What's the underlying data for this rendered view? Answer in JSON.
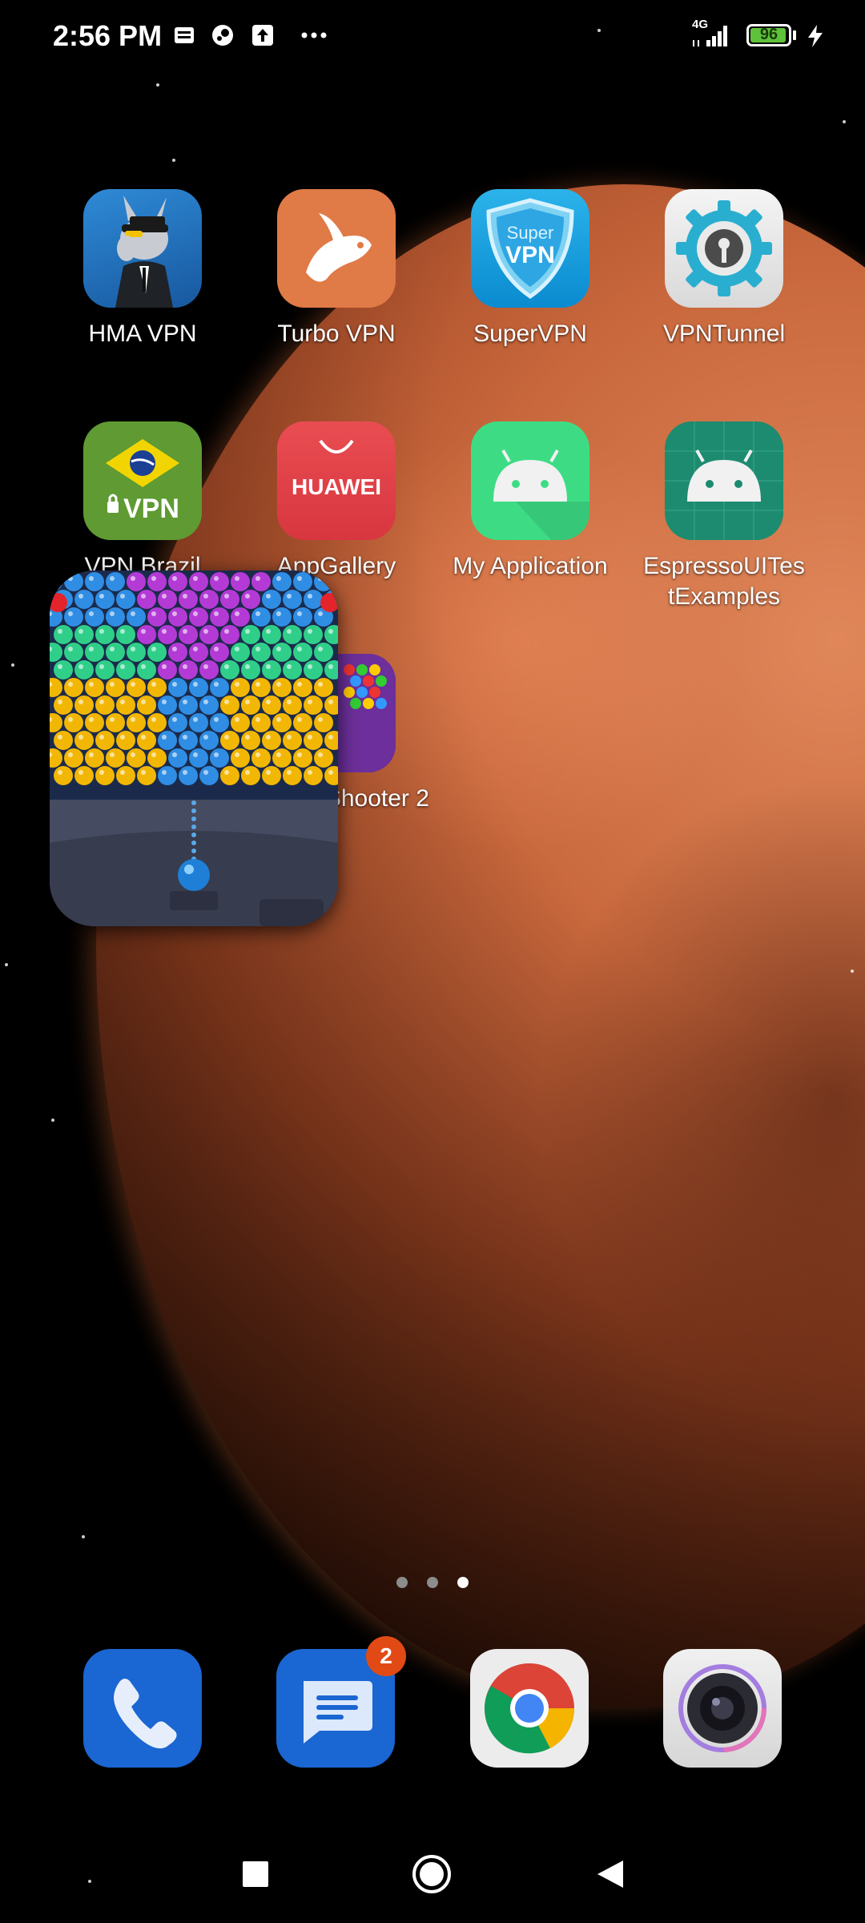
{
  "status_bar": {
    "time": "2:56 PM",
    "network": "4G",
    "battery_level": "96",
    "battery_fraction": 0.96,
    "notification_icons": [
      "news-icon",
      "steam-icon",
      "upload-icon",
      "more-icon"
    ]
  },
  "apps": [
    {
      "label": "HMA VPN"
    },
    {
      "label": "Turbo VPN"
    },
    {
      "label": "SuperVPN"
    },
    {
      "label": "VPNTunnel"
    },
    {
      "label": "VPN Brazil"
    },
    {
      "label": "AppGallery"
    },
    {
      "label": "My Application"
    },
    {
      "label": "EspressoUITes tExamples"
    },
    {
      "label": "Bubble Shooter 2"
    }
  ],
  "app_icon_text": {
    "supervpn_top": "Super",
    "supervpn_bottom": "VPN",
    "vpnbrazil": "VPN",
    "appgallery": "HUAWEI"
  },
  "pages": {
    "count": 3,
    "current": 3
  },
  "dock": {
    "messages_badge": "2",
    "items": [
      "phone-icon",
      "messages-icon",
      "chrome-icon",
      "camera-icon"
    ]
  },
  "colors": {
    "battery": "#5ec23a",
    "badge": "#e24a15",
    "hma_blue": "#1f6fb5",
    "turbo_orange": "#e07a47",
    "android_green": "#3ddc84"
  }
}
